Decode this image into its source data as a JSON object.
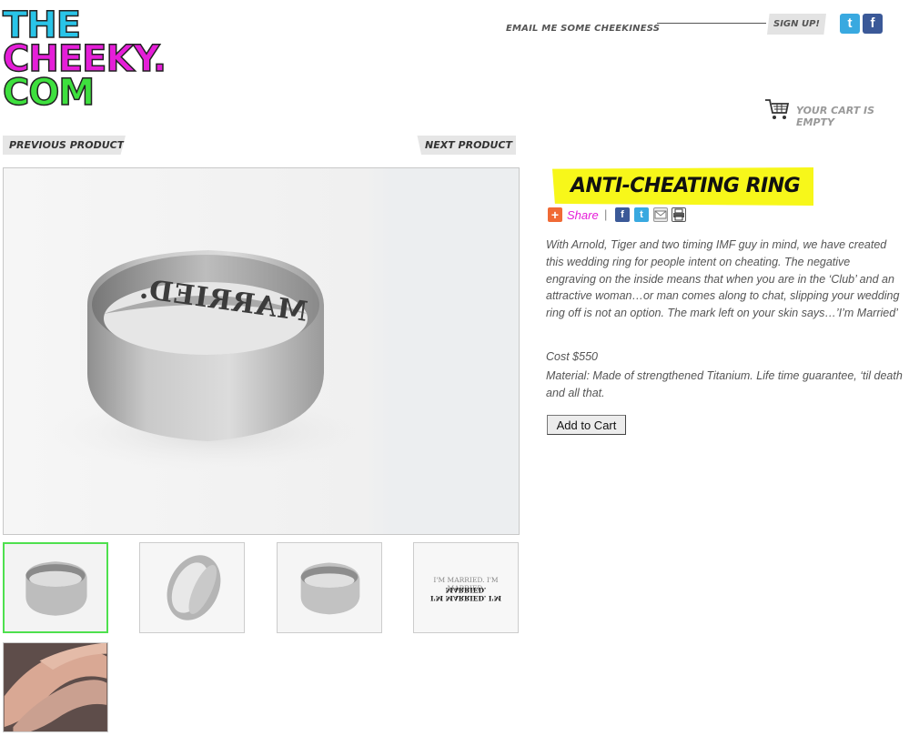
{
  "logo": {
    "line1": "THE",
    "line2": "CHEEKY.",
    "line3": "COM"
  },
  "header": {
    "email_label": "EMAIL ME SOME CHEEKINESS",
    "signup_label": "SIGN UP!",
    "twitter_glyph": "t",
    "facebook_glyph": "f"
  },
  "cart": {
    "status": "YOUR CART IS EMPTY",
    "icon": "shopping-cart-icon"
  },
  "nav": {
    "previous": "PREVIOUS PRODUCT",
    "next": "NEXT PRODUCT"
  },
  "product": {
    "title": "ANTI-CHEATING RING",
    "share_label": "Share",
    "share_separator": "|",
    "description": "With Arnold, Tiger and two timing IMF guy in mind, we have created this wedding ring for people intent on cheating. The negative engraving on the inside means that when you are in the ‘Club’ and an attractive woman…or man comes along to chat, slipping your wedding ring off is not an option. The mark left on your skin says…’I’m Married’",
    "cost": "Cost $550",
    "material": "Material: Made of strengthened Titanium. Life time guarantee, ‘til death and all that.",
    "add_to_cart": "Add to Cart",
    "engraving": "MARRIED.",
    "thumb4_line1": "I'M MARRIED. I'M MARRIED.",
    "thumb4_line2": "I'M MARRIED. I'M MARRIED."
  },
  "colors": {
    "logo_line1": "#29c4e8",
    "logo_line2": "#e51ed8",
    "logo_line3": "#3ee03e",
    "title_highlight": "#f7f71a",
    "share_link": "#e51ed8",
    "active_thumb_border": "#4ee04e"
  }
}
